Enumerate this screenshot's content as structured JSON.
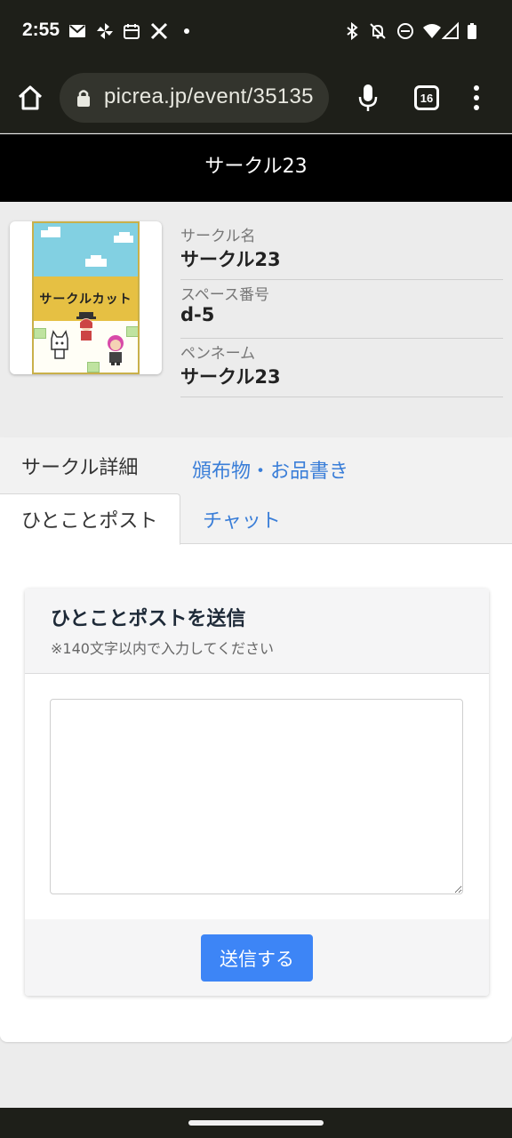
{
  "status_bar": {
    "time": "2:55",
    "icons": [
      "gmail-icon",
      "pinwheel-icon",
      "calendar-icon",
      "x-icon",
      "dot-icon",
      "bluetooth-icon",
      "bell-off-icon",
      "do-not-disturb-icon",
      "wifi-icon",
      "signal-icon",
      "battery-icon"
    ]
  },
  "browser": {
    "url": "picrea.jp/event/35135",
    "tab_count": "16"
  },
  "page": {
    "title": "サークル23"
  },
  "circle": {
    "cut_text": "サークルカット",
    "fields": [
      {
        "label": "サークル名",
        "value": "サークル23"
      },
      {
        "label": "スペース番号",
        "value": "d-5"
      },
      {
        "label": "ペンネーム",
        "value": "サークル23"
      }
    ]
  },
  "tabs": {
    "detail": "サークル詳細",
    "items": "頒布物・お品書き",
    "post": "ひとことポスト",
    "chat": "チャット"
  },
  "post_form": {
    "title": "ひとことポストを送信",
    "note": "※140文字以内で入力してください",
    "textarea_value": "",
    "submit_label": "送信する"
  },
  "colors": {
    "link": "#3a7ed8",
    "button": "#3d85f6",
    "header_bg": "#000000"
  }
}
